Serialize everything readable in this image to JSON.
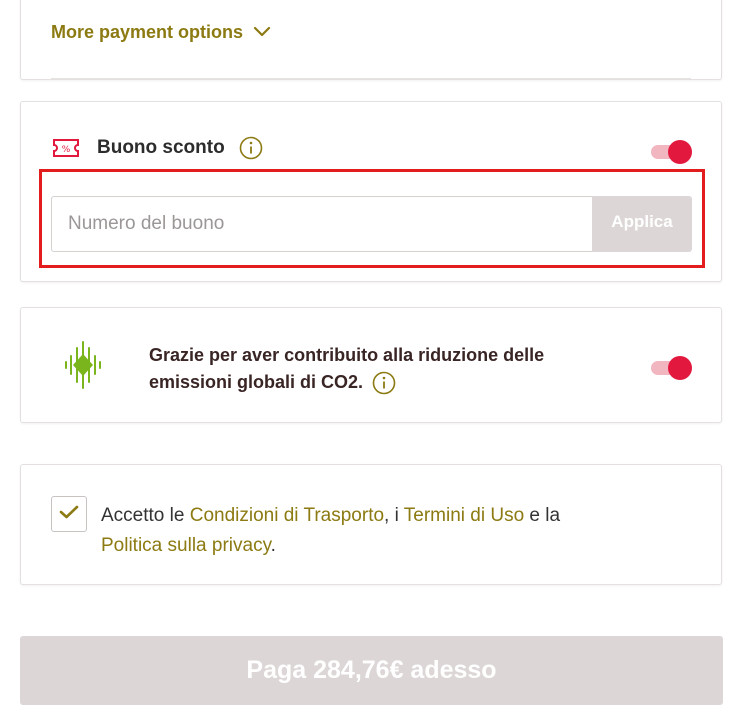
{
  "payment": {
    "more_options_label": "More payment options"
  },
  "voucher": {
    "title": "Buono sconto",
    "input_placeholder": "Numero del buono",
    "apply_label": "Applica",
    "toggle_on": true
  },
  "co2": {
    "text": "Grazie per aver contribuito alla riduzione delle emissioni globali di CO2.",
    "toggle_on": true
  },
  "terms": {
    "prefix": "Accetto le ",
    "link_conditions": "Condizioni di Trasporto",
    "sep1": ", i ",
    "link_terms": "Termini di Uso",
    "sep2": " e la ",
    "link_privacy": "Politica sulla privacy",
    "suffix": ".",
    "checked": true
  },
  "pay": {
    "label": "Paga 284,76€ adesso"
  },
  "colors": {
    "accent_olive": "#8c7a12",
    "toggle_red": "#e2183f",
    "highlight_red": "#e31d1d",
    "icon_green": "#7ab51d",
    "disabled_button": "#dcd6d6"
  }
}
